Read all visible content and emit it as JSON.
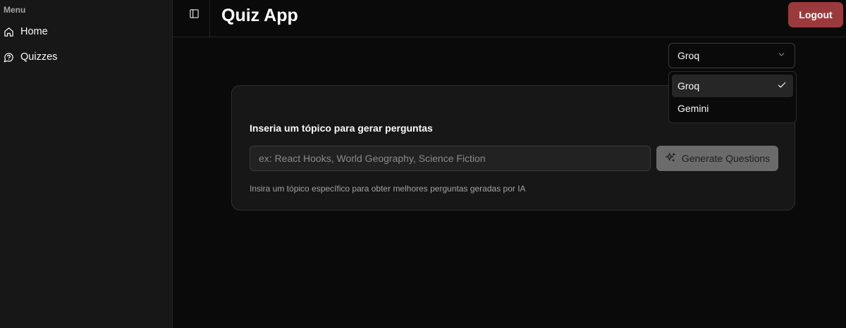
{
  "sidebar": {
    "group_label": "Menu",
    "items": [
      {
        "label": "Home",
        "icon": "home-icon"
      },
      {
        "label": "Quizzes",
        "icon": "message-circle-question-icon"
      }
    ]
  },
  "header": {
    "title": "Quiz App",
    "logout_label": "Logout",
    "toggle_icon": "panel-left-icon"
  },
  "model_select": {
    "value": "Groq",
    "options": [
      {
        "label": "Groq",
        "selected": true
      },
      {
        "label": "Gemini",
        "selected": false
      }
    ]
  },
  "generator": {
    "label": "Inseria um tópico para gerar perguntas",
    "placeholder": "ex: React Hooks, World Geography, Science Fiction",
    "value": "",
    "button_label": "Generate Questions",
    "button_icon": "sparkles-icon",
    "helper": "Insira um tópico específico para obter melhores perguntas geradas por IA"
  },
  "colors": {
    "background": "#0a0a0a",
    "sidebar": "#171717",
    "logout": "#9b3a3d",
    "button_disabled": "#6b6b6b"
  }
}
